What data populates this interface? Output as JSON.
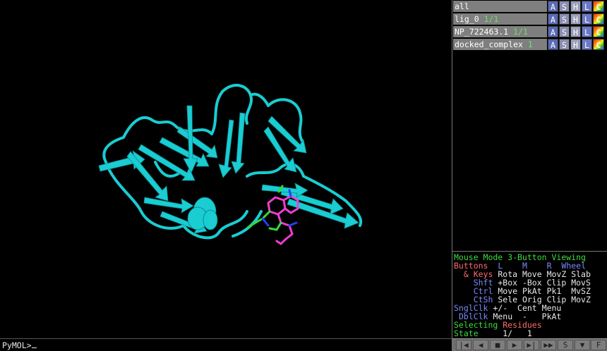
{
  "objects": [
    {
      "name": "all",
      "state": ""
    },
    {
      "name": "lig_0",
      "state": "1/1"
    },
    {
      "name": "NP_722463.1",
      "state": "1/1"
    },
    {
      "name": "docked_complex",
      "state": "1"
    }
  ],
  "object_buttons": {
    "action": "A",
    "show": "S",
    "hide": "H",
    "label": "L",
    "color": "C"
  },
  "mouse": {
    "title": "Mouse Mode 3-Button Viewing",
    "buttons_label": "Buttons",
    "col_l": "L",
    "col_m": "M",
    "col_r": "R",
    "col_wheel": "Wheel",
    "keys_label": "& Keys",
    "keys_row": "Rota Move MovZ Slab",
    "shft_label": "Shft",
    "shft_row": "+Box -Box Clip MovS",
    "ctrl_label": "Ctrl",
    "ctrl_row": "Move PkAt Pk1  MvSZ",
    "ctsh_label": "CtSh",
    "ctsh_row": "Sele Orig Clip MovZ",
    "snglclk_label": "SnglClk",
    "snglclk_row": "+/-  Cent Menu",
    "dblclk_label": "DblClk",
    "dblclk_row": "Menu  -   PkAt",
    "selecting_label": "Selecting",
    "selecting_value": "Residues",
    "state_label": "State",
    "state_value": "1/   1"
  },
  "command": {
    "prompt": "PyMOL>"
  },
  "playback": [
    "|◀",
    "◀",
    "■",
    "▶",
    "▶|",
    "▶▶",
    "S",
    "▼",
    "F"
  ],
  "colors": {
    "ribbon": "#19cdd2",
    "ligand_c": "#ee3fd0",
    "ligand_n": "#2a3cff",
    "ligand_c2": "#37d937",
    "panel_gray": "#7f7f7f"
  }
}
